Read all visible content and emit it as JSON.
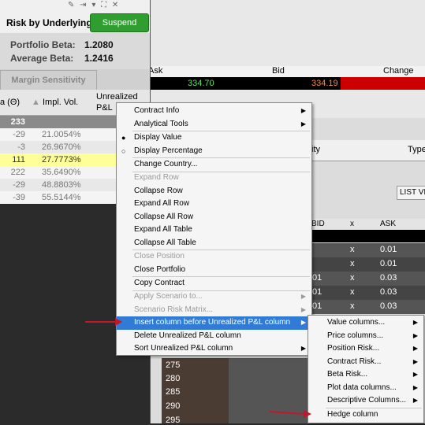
{
  "window": {
    "title": "Risk by Underlying",
    "suspend_label": "Suspend",
    "controls": "✎ ⇥ ▾ ⛶ ✕"
  },
  "beta": {
    "portfolio_label": "Portfolio Beta:",
    "portfolio_value": "1.2080",
    "average_label": "Average Beta:",
    "average_value": "1.2416"
  },
  "tabs": {
    "margin_sensitivity": "Margin Sensitivity"
  },
  "columns": {
    "theta": "a (Θ)",
    "impl_vol": "Impl. Vol.",
    "unrealized_line1": "Unrealized",
    "unrealized_line2": "P&L"
  },
  "rows": [
    {
      "theta": "233",
      "impl_vol": ""
    },
    {
      "theta": "-29",
      "impl_vol": "21.0054%"
    },
    {
      "theta": "-3",
      "impl_vol": "26.9670%"
    },
    {
      "theta": "111",
      "impl_vol": "27.7773%"
    },
    {
      "theta": "222",
      "impl_vol": "35.6490%"
    },
    {
      "theta": "-29",
      "impl_vol": "48.8803%"
    },
    {
      "theta": "-39",
      "impl_vol": "55.5144%"
    }
  ],
  "quote": {
    "ask_label": "Ask",
    "bid_label": "Bid",
    "change_label": "Change",
    "ask_value": "334.70",
    "bid_value": "334.19"
  },
  "panel2": {
    "ity_label": "ity",
    "type_label": "Type",
    "list_view": "LIST VI"
  },
  "chain": {
    "headers": {
      "bid": "BID",
      "x": "x",
      "ask": "ASK"
    },
    "rows": [
      {
        "bid": "",
        "x": "x",
        "ask": "0.01"
      },
      {
        "bid": "",
        "x": "x",
        "ask": "0.01"
      },
      {
        "bid": ".01",
        "x": "x",
        "ask": "0.03"
      },
      {
        "bid": ".01",
        "x": "x",
        "ask": "0.03"
      },
      {
        "bid": ".01",
        "x": "x",
        "ask": "0.03"
      }
    ]
  },
  "strikes": [
    "275",
    "280",
    "285",
    "290",
    "295"
  ],
  "context_menu": {
    "items": [
      {
        "label": "Contract Info",
        "arrow": "▶"
      },
      {
        "label": "Analytical Tools",
        "arrow": "▶"
      },
      {
        "label": "Display Value",
        "radio": "●"
      },
      {
        "label": "Display Percentage",
        "radio": "○"
      },
      {
        "label": "Change Country..."
      },
      {
        "label": "Expand Row"
      },
      {
        "label": "Collapse Row"
      },
      {
        "label": "Expand All Row"
      },
      {
        "label": "Collapse All Row"
      },
      {
        "label": "Expand All Table"
      },
      {
        "label": "Collapse All Table"
      },
      {
        "label": "Close Position"
      },
      {
        "label": "Close Portfolio"
      },
      {
        "label": "Copy Contract"
      },
      {
        "label": "Apply Scenario to...",
        "arrow": "▶"
      },
      {
        "label": "Scenario Risk Matrix...",
        "arrow": "▶"
      },
      {
        "label": "Insert column before Unrealized P&L column",
        "arrow": "▶"
      },
      {
        "label": "Delete Unrealized P&L column"
      },
      {
        "label": "Sort Unrealized P&L column",
        "arrow": "▶"
      }
    ]
  },
  "submenu": {
    "items": [
      {
        "label": "Value columns...",
        "arrow": "▶"
      },
      {
        "label": "Price columns...",
        "arrow": "▶"
      },
      {
        "label": "Position Risk...",
        "arrow": "▶"
      },
      {
        "label": "Contract Risk...",
        "arrow": "▶"
      },
      {
        "label": "Beta Risk...",
        "arrow": "▶"
      },
      {
        "label": "Plot data columns...",
        "arrow": "▶"
      },
      {
        "label": "Descriptive Columns...",
        "arrow": "▶"
      },
      {
        "label": "Hedge column"
      }
    ]
  },
  "colors": {
    "suspend": "#2e9e2e",
    "highlight_row": "#ffff99",
    "menu_highlight": "#2f7bd6",
    "annotation_arrow": "#c0182a",
    "ask_value": "#66dd66",
    "bid_value": "#ff8844",
    "change_bar": "#cc0000"
  }
}
